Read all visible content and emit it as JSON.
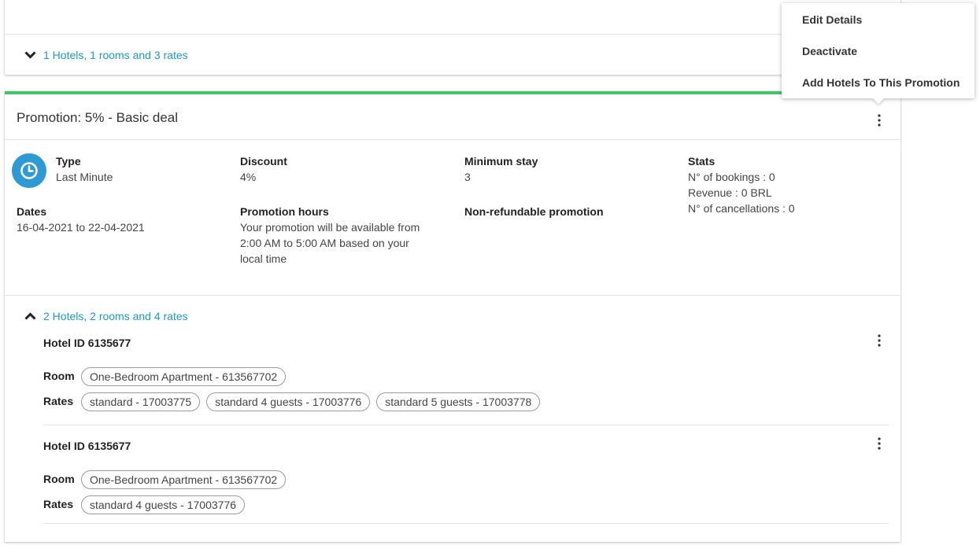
{
  "top_card": {
    "summary_link": "1 Hotels, 1 rooms and 3 rates"
  },
  "promotion": {
    "title": "Promotion: 5% - Basic deal",
    "accent_color": "#43c46a",
    "type": {
      "label": "Type",
      "value": "Last Minute",
      "icon": "clock-icon"
    },
    "discount": {
      "label": "Discount",
      "value": "4%"
    },
    "minimum_stay": {
      "label": "Minimum stay",
      "value": "3"
    },
    "stats": {
      "label": "Stats",
      "bookings": "N° of bookings : 0",
      "revenue": "Revenue : 0 BRL",
      "cancellations": "N° of cancellations : 0"
    },
    "dates": {
      "label": "Dates",
      "value": "16-04-2021 to 22-04-2021"
    },
    "promotion_hours": {
      "label": "Promotion hours",
      "line1": "Your promotion will be available from",
      "line2": "2:00 AM to 5:00 AM based on your",
      "line3": "local time"
    },
    "non_refundable": "Non-refundable promotion",
    "hotels_link": "2 Hotels, 2 rooms and 4 rates",
    "room_label": "Room",
    "rates_label": "Rates",
    "hotels": [
      {
        "name": "Hotel ID 6135677",
        "room": "One-Bedroom Apartment - 613567702",
        "rates": [
          "standard - 17003775",
          "standard 4 guests - 17003776",
          "standard 5 guests - 17003778"
        ]
      },
      {
        "name": "Hotel ID 6135677",
        "room": "One-Bedroom Apartment - 613567702",
        "rates": [
          "standard 4 guests - 17003776"
        ]
      }
    ]
  },
  "menu": {
    "items": [
      "Edit Details",
      "Deactivate",
      "Add Hotels To This Promotion"
    ]
  }
}
